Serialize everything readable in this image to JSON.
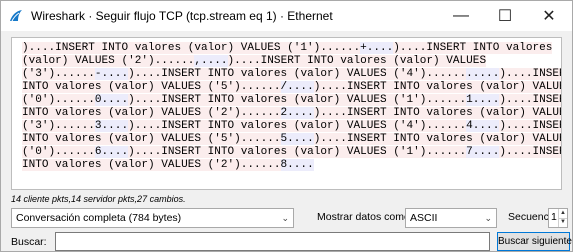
{
  "window": {
    "title": "Wireshark · Seguir flujo TCP (tcp.stream eq 1) · Ethernet",
    "controls": {
      "minimize": "—",
      "maximize": "☐",
      "close": "✕"
    }
  },
  "stream": {
    "lines": [
      [
        {
          "t": ")....INSERT INTO valores (valor) VALUES ('1')......",
          "dir": "client"
        },
        {
          "t": "+....",
          "dir": "server"
        },
        {
          "t": ")....INSERT INTO valores",
          "dir": "client"
        }
      ],
      [
        {
          "t": "(valor) VALUES ('2')......",
          "dir": "client"
        },
        {
          "t": ",....",
          "dir": "server"
        },
        {
          "t": ")....INSERT INTO valores (valor) VALUES",
          "dir": "client"
        }
      ],
      [
        {
          "t": "('3')......",
          "dir": "client"
        },
        {
          "t": "-....",
          "dir": "server"
        },
        {
          "t": ")....INSERT INTO valores (valor) VALUES ('4')......",
          "dir": "client"
        },
        {
          "t": ".....",
          "dir": "server"
        },
        {
          "t": ")....INSERT",
          "dir": "client"
        }
      ],
      [
        {
          "t": "INTO valores (valor) VALUES ('5')......",
          "dir": "client"
        },
        {
          "t": "/....",
          "dir": "server"
        },
        {
          "t": ")....INSERT INTO valores (valor) VALUES",
          "dir": "client"
        }
      ],
      [
        {
          "t": "('0')......",
          "dir": "client"
        },
        {
          "t": "0....",
          "dir": "server"
        },
        {
          "t": ")....INSERT INTO valores (valor) VALUES ('1')......",
          "dir": "client"
        },
        {
          "t": "1....",
          "dir": "server"
        },
        {
          "t": ")....INSERT",
          "dir": "client"
        }
      ],
      [
        {
          "t": "INTO valores (valor) VALUES ('2')......",
          "dir": "client"
        },
        {
          "t": "2....",
          "dir": "server"
        },
        {
          "t": ")....INSERT INTO valores (valor) VALUES",
          "dir": "client"
        }
      ],
      [
        {
          "t": "('3')......",
          "dir": "client"
        },
        {
          "t": "3....",
          "dir": "server"
        },
        {
          "t": ")....INSERT INTO valores (valor) VALUES ('4')......",
          "dir": "client"
        },
        {
          "t": "4....",
          "dir": "server"
        },
        {
          "t": ")....INSERT",
          "dir": "client"
        }
      ],
      [
        {
          "t": "INTO valores (valor) VALUES ('5')......",
          "dir": "client"
        },
        {
          "t": "5....",
          "dir": "server"
        },
        {
          "t": ")....INSERT INTO valores (valor) VALUES",
          "dir": "client"
        }
      ],
      [
        {
          "t": "('0')......",
          "dir": "client"
        },
        {
          "t": "6....",
          "dir": "server"
        },
        {
          "t": ")....INSERT INTO valores (valor) VALUES ('1')......",
          "dir": "client"
        },
        {
          "t": "7....",
          "dir": "server"
        },
        {
          "t": ")....INSERT",
          "dir": "client"
        }
      ],
      [
        {
          "t": "INTO valores (valor) VALUES ('2')......",
          "dir": "client"
        },
        {
          "t": "8....",
          "dir": "server"
        }
      ]
    ]
  },
  "stats": "14 cliente pkts,14 servidor pkts,27 cambios.",
  "conversation_select": {
    "value": "Conversación completa (784 bytes)"
  },
  "show_data": {
    "label": "Mostrar datos como",
    "value": "ASCII"
  },
  "sequence": {
    "label": "Secuencia",
    "value": "1"
  },
  "search": {
    "label": "Buscar:",
    "value": "",
    "placeholder": ""
  },
  "find_next_label": "Buscar siguiente",
  "colors": {
    "client_bg": "#fbeded",
    "server_bg": "#ececfb",
    "focus_border": "#0078d7"
  },
  "icons": {
    "app": "wireshark-fin-icon",
    "dropdown": "chevron-down-icon"
  }
}
